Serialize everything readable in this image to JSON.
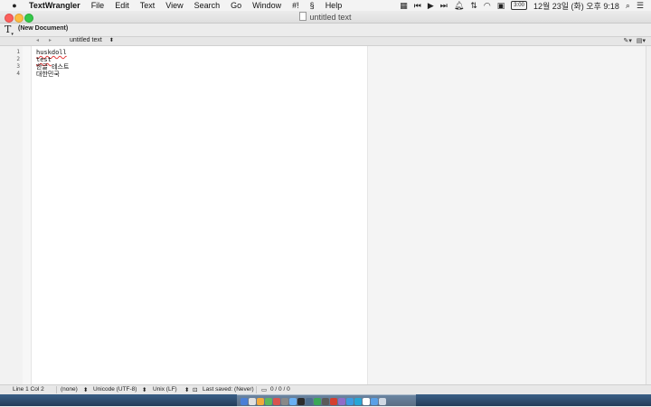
{
  "menubar": {
    "app_name": "TextWrangler",
    "items": [
      "File",
      "Edit",
      "Text",
      "View",
      "Search",
      "Go",
      "Window",
      "#!",
      "Help"
    ],
    "clock": "12월 23일 (화) 오후 9:18",
    "battery_label": "3:00"
  },
  "window": {
    "title": "untitled text"
  },
  "toolbar": {
    "text_tool_label": "T",
    "document_label": "(New Document)"
  },
  "navbar": {
    "back_arrow": "◂",
    "forward_arrow": "▸",
    "document_name": "untitled text",
    "document_chevron": "⬍"
  },
  "editor": {
    "line_numbers": [
      "1",
      "2",
      "3",
      "4"
    ],
    "lines": [
      "huskdoll",
      "test",
      "한글 테스트",
      "대한민국"
    ]
  },
  "statusbar": {
    "position": "Line 1 Col 2",
    "language": "(none)",
    "encoding": "Unicode (UTF-8)",
    "line_endings": "Unix (LF)",
    "last_saved": "Last saved: (Never)",
    "counts": "0 / 0 / 0"
  },
  "colors": {
    "close": "#fc605c",
    "minimize": "#fdbc40",
    "maximize": "#34c84a",
    "spelling_underline": "#e43b3b"
  },
  "dock": {
    "icon_colors": [
      "#4a7fd6",
      "#e0e0e0",
      "#f2a93b",
      "#5cb85c",
      "#d9534f",
      "#888888",
      "#6ab0f3",
      "#2c2c2c",
      "#4e6e8e",
      "#3aa757",
      "#5b5b5b",
      "#d33f2f",
      "#8f6cc8",
      "#3c9be0",
      "#26a6d6",
      "#ffffff",
      "#5aa0e6",
      "#cfd8e3"
    ]
  }
}
